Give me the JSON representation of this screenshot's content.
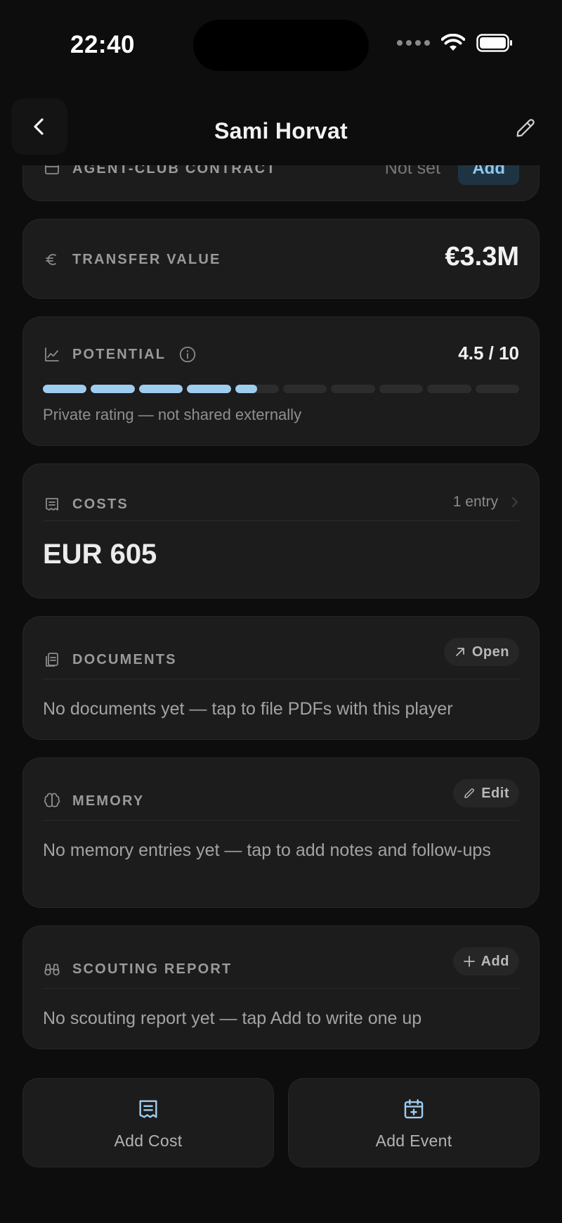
{
  "status_bar": {
    "time": "22:40"
  },
  "nav": {
    "title": "Sami Horvat"
  },
  "contract": {
    "label": "AGENT-CLUB CONTRACT",
    "status": "Not set",
    "action_label": "Add"
  },
  "transfer": {
    "label": "TRANSFER VALUE",
    "value": "€3.3M"
  },
  "potential": {
    "label": "POTENTIAL",
    "score_text": "4.5 / 10",
    "score": 4.5,
    "max": 10,
    "note": "Private rating — not shared externally"
  },
  "costs": {
    "label": "COSTS",
    "count_text": "1 entry",
    "amount": "EUR 605"
  },
  "documents": {
    "label": "DOCUMENTS",
    "action_label": "Open",
    "empty_text": "No documents yet — tap to file PDFs with this player"
  },
  "memory": {
    "label": "MEMORY",
    "action_label": "Edit",
    "empty_text": "No memory entries yet — tap to add notes and follow-ups"
  },
  "scouting": {
    "label": "SCOUTING REPORT",
    "action_label": "Add",
    "empty_text": "No scouting report yet — tap Add to write one up"
  },
  "actions": {
    "add_cost": "Add Cost",
    "add_event": "Add Event"
  },
  "colors": {
    "accent": "#9fcdf0",
    "background": "#0d0d0d",
    "card": "#1c1c1c"
  }
}
